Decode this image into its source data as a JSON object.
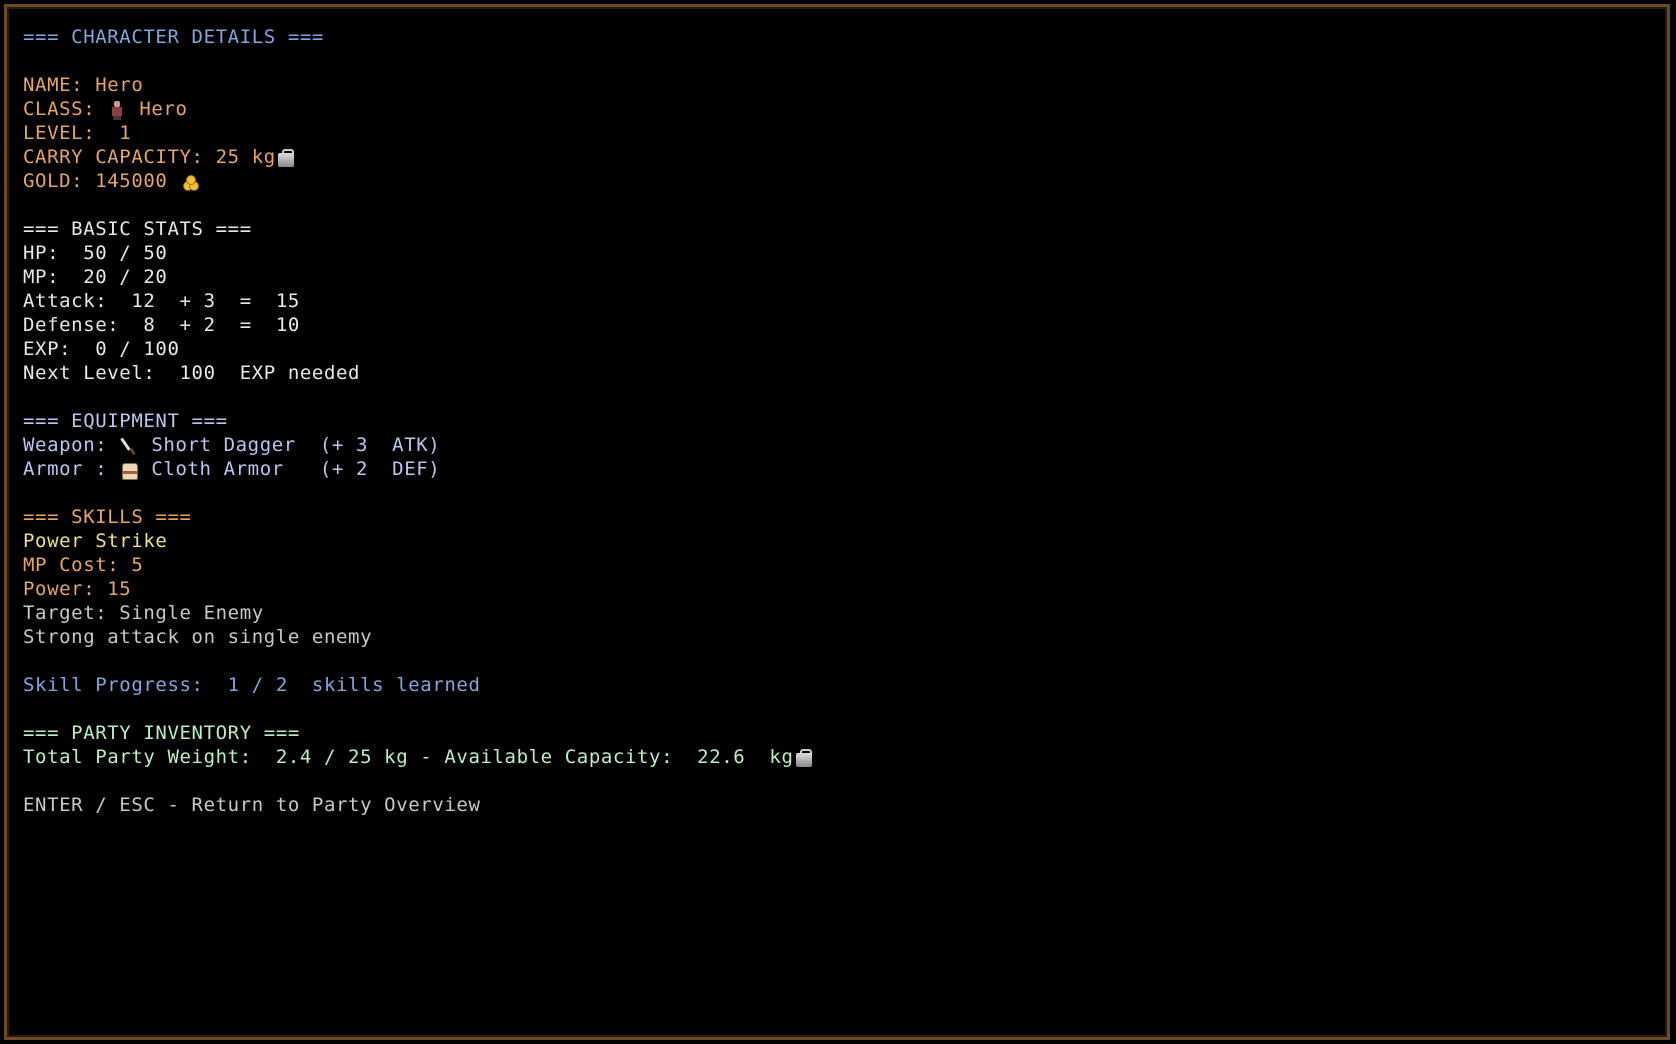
{
  "header": {
    "title": "=== CHARACTER DETAILS ==="
  },
  "character": {
    "name_line": "NAME: Hero",
    "class_label": "CLASS:",
    "class_value": "Hero",
    "level_line": "LEVEL:  1",
    "carry_line": "CARRY CAPACITY: 25 kg",
    "gold_line": "GOLD: 145000"
  },
  "basic_stats": {
    "heading": "=== BASIC STATS ===",
    "hp": "HP:  50 / 50",
    "mp": "MP:  20 / 20",
    "attack": "Attack:  12  + 3  =  15",
    "defense": "Defense:  8  + 2  =  10",
    "exp": "EXP:  0 / 100",
    "next_level": "Next Level:  100  EXP needed"
  },
  "equipment": {
    "heading": "=== EQUIPMENT ===",
    "weapon_label": "Weapon:",
    "weapon_value": "Short Dagger  (+ 3  ATK)",
    "armor_label": "Armor :",
    "armor_value": "Cloth Armor   (+ 2  DEF)"
  },
  "skills": {
    "heading": "=== SKILLS ===",
    "name": "Power Strike",
    "mp_cost": "MP Cost: 5",
    "power": "Power: 15",
    "target": "Target: Single Enemy",
    "description": "Strong attack on single enemy",
    "progress": "Skill Progress:  1 / 2  skills learned"
  },
  "inventory": {
    "heading": "=== PARTY INVENTORY ===",
    "weight_line": "Total Party Weight:  2.4 / 25 kg - Available Capacity:  22.6  kg"
  },
  "footer": {
    "hint": "ENTER / ESC - Return to Party Overview"
  },
  "icons": {
    "class": "hero-figure-icon",
    "carry": "weight-icon",
    "gold": "gold-coins-icon",
    "weapon": "dagger-icon",
    "armor": "cloth-armor-icon",
    "inventory": "weight-icon"
  },
  "colors": {
    "border": "#6b4a2a",
    "heading": "#7fa6e0",
    "character_info": "#e8a560",
    "stats": "#e8e8e8",
    "equipment": "#b8c6f0",
    "skill_name": "#f0e080",
    "inventory": "#b8f0c0"
  }
}
